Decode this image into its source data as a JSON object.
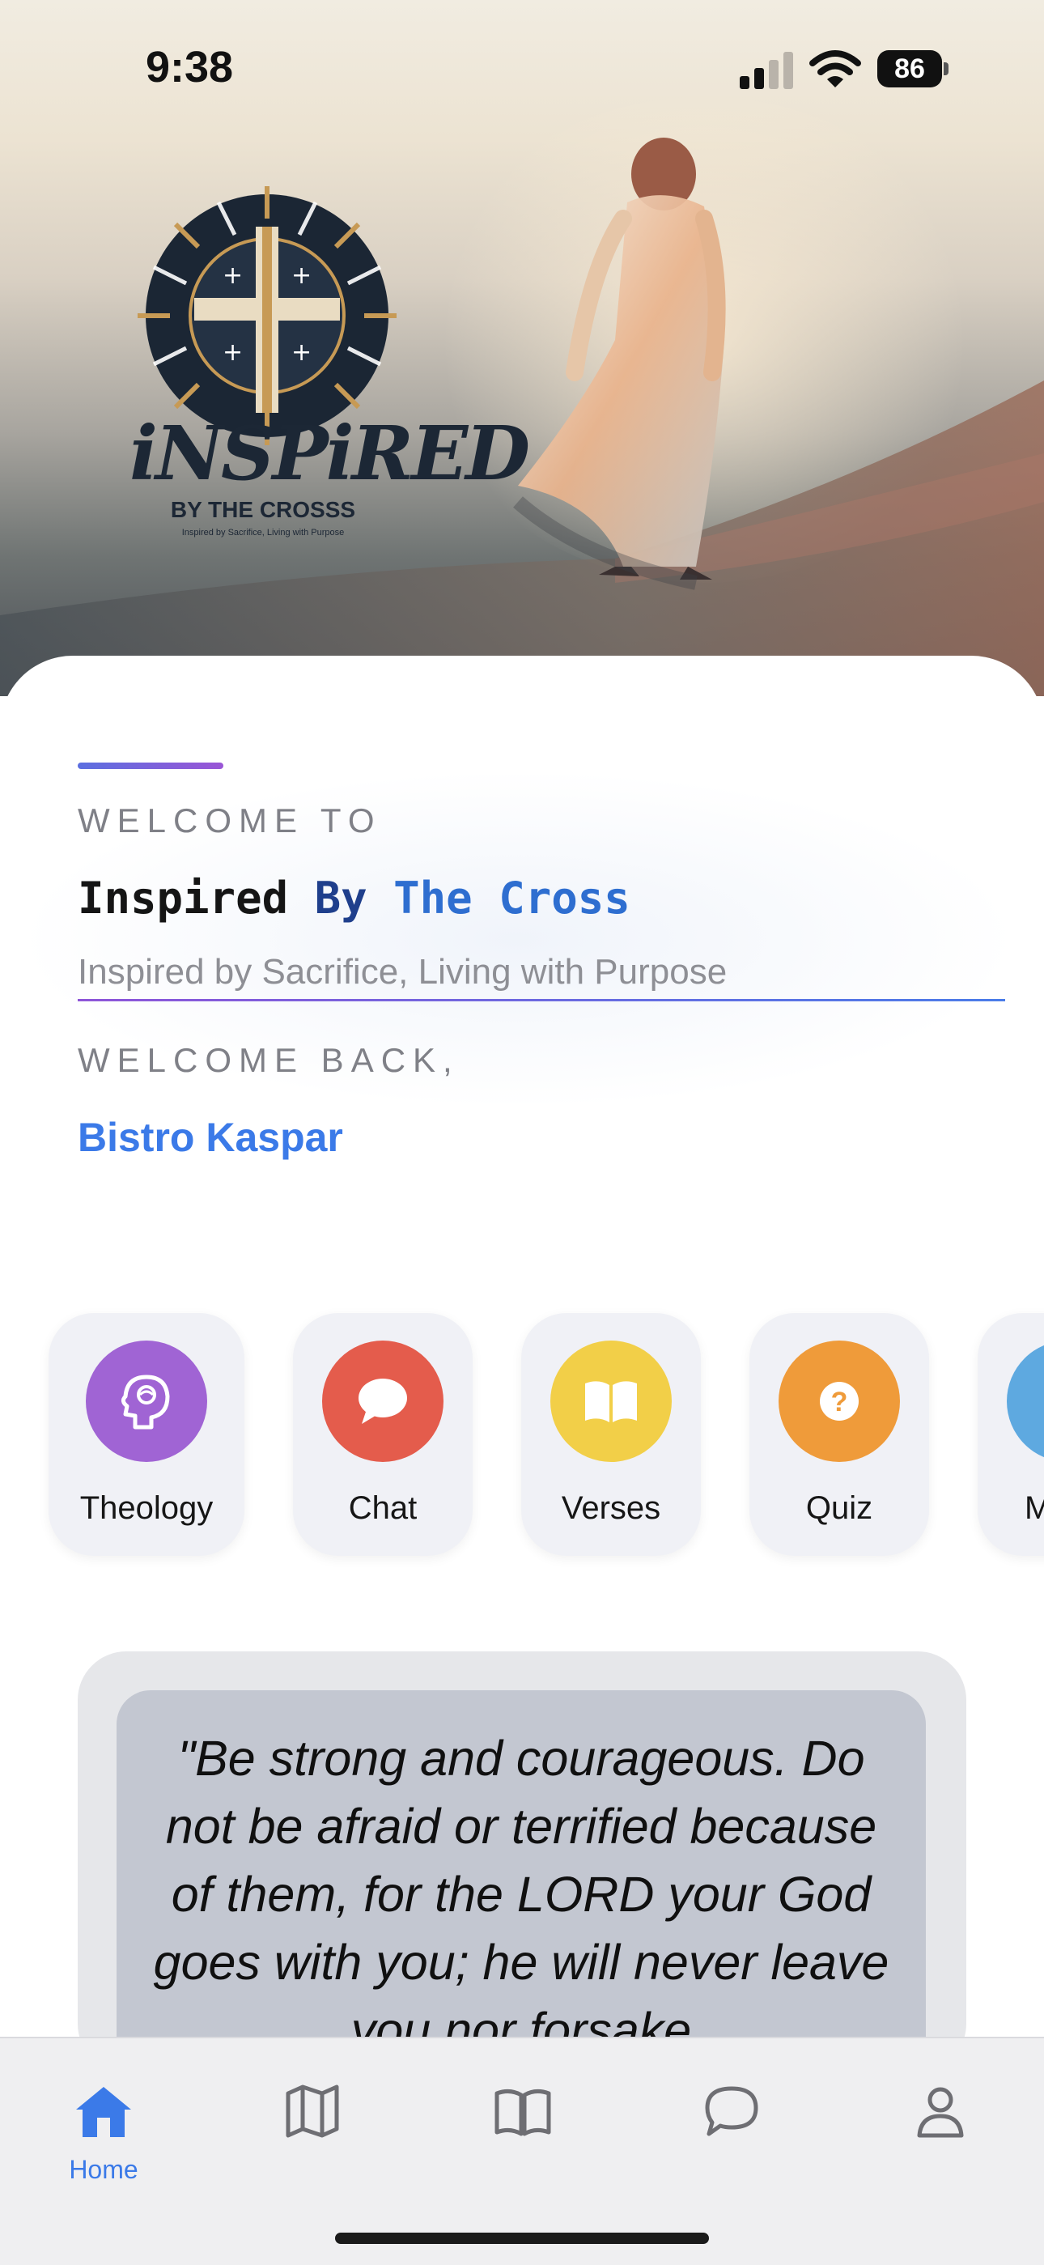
{
  "status_bar": {
    "time": "9:38",
    "battery": "86"
  },
  "logo": {
    "title": "iNSPiRED",
    "subtitle": "BY THE CROSSS",
    "tagline": "Inspired by Sacrifice, Living with Purpose"
  },
  "welcome": {
    "welcome_to": "WELCOME TO",
    "app_title": {
      "part1": "Inspired",
      "part2": "By",
      "part3": "The Cross"
    },
    "tagline": "Inspired by Sacrifice, Living with Purpose",
    "welcome_back": "WELCOME BACK,",
    "username": "Bistro Kaspar"
  },
  "features": [
    {
      "label": "Theology",
      "icon": "brain-icon",
      "color": "#a064d4"
    },
    {
      "label": "Chat",
      "icon": "chat-bubble-icon",
      "color": "#e45c4c"
    },
    {
      "label": "Verses",
      "icon": "book-icon",
      "color": "#f2cf48"
    },
    {
      "label": "Quiz",
      "icon": "question-icon",
      "color": "#ef9b3a"
    },
    {
      "label": "M",
      "icon": "partial-icon",
      "color": "#5ea9e0"
    }
  ],
  "verse": {
    "text": "\"Be strong and courageous. Do not be afraid or terrified because of them, for the LORD your God goes with you; he will never leave you nor forsake"
  },
  "tab_bar": {
    "items": [
      {
        "label": "Home",
        "icon": "home-icon",
        "active": true
      },
      {
        "label": "",
        "icon": "map-icon",
        "active": false
      },
      {
        "label": "",
        "icon": "book-icon",
        "active": false
      },
      {
        "label": "",
        "icon": "chat-icon",
        "active": false
      },
      {
        "label": "",
        "icon": "profile-icon",
        "active": false
      }
    ]
  },
  "colors": {
    "accent": "#3b7ae8",
    "title_dark": "#1f3f8c"
  }
}
